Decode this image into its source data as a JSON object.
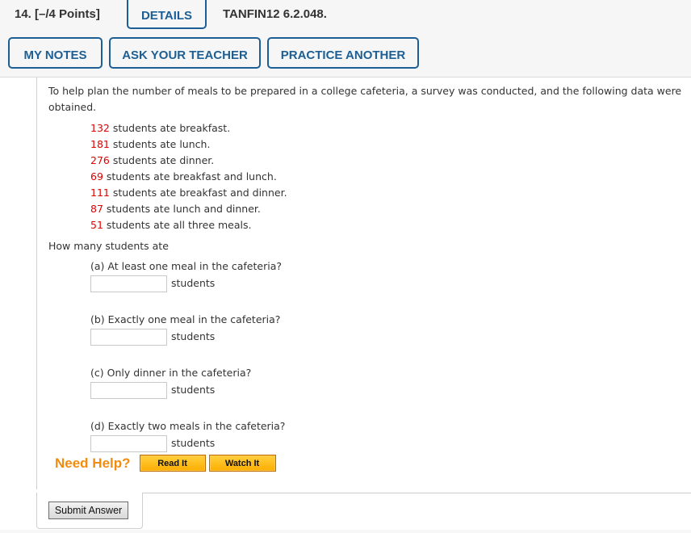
{
  "header": {
    "question_number": "14.  [–/4 Points]",
    "details_label": "DETAILS",
    "question_code": "TANFIN12 6.2.048.",
    "buttons": {
      "my_notes": "MY NOTES",
      "ask_teacher": "ASK YOUR TEACHER",
      "practice_another": "PRACTICE ANOTHER"
    }
  },
  "problem": {
    "intro": "To help plan the number of meals to be prepared in a college cafeteria, a survey was conducted, and the following data were obtained.",
    "facts": [
      {
        "value": "132",
        "text": " students ate breakfast."
      },
      {
        "value": "181",
        "text": " students ate lunch."
      },
      {
        "value": "276",
        "text": " students ate dinner."
      },
      {
        "value": "69",
        "text": " students ate breakfast and lunch."
      },
      {
        "value": "111",
        "text": " students ate breakfast and dinner."
      },
      {
        "value": "87",
        "text": " students ate lunch and dinner."
      },
      {
        "value": "51",
        "text": " students ate all three meals."
      }
    ],
    "question": "How many students ate",
    "parts": [
      {
        "label": "(a) At least one meal in the cafeteria?",
        "value": "",
        "unit": "students"
      },
      {
        "label": "(b) Exactly one meal in the cafeteria?",
        "value": "",
        "unit": "students"
      },
      {
        "label": "(c) Only dinner in the cafeteria?",
        "value": "",
        "unit": "students"
      },
      {
        "label": "(d) Exactly two meals in the cafeteria?",
        "value": "",
        "unit": "students"
      }
    ]
  },
  "help": {
    "label": "Need Help?",
    "read_it": "Read It",
    "watch_it": "Watch It"
  },
  "submit_label": "Submit Answer",
  "colors": {
    "accent_blue": "#1d5f94",
    "data_red": "#e00000",
    "help_orange": "#f28c0f",
    "button_orange": "#ffad00"
  }
}
